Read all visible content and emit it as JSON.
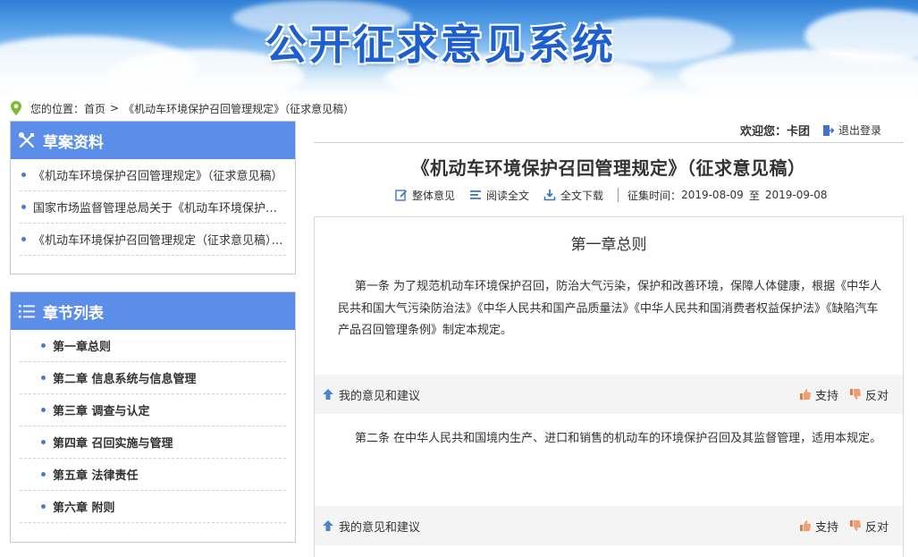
{
  "banner": {
    "title": "公开征求意见系统"
  },
  "breadcrumb": {
    "prefix": "您的位置：",
    "home": "首页",
    "separator": ">",
    "current": "《机动车环境保护召回管理规定》（征求意见稿）"
  },
  "sidebar": {
    "docs_panel": {
      "title": "草案资料",
      "items": [
        {
          "label": "《机动车环境保护召回管理规定》（征求意见稿）"
        },
        {
          "label": "国家市场监督管理总局关于《机动车环境保护召回管理规定》"
        },
        {
          "label": "《机动车环境保护召回管理规定（征求意见稿）》起草说明"
        }
      ]
    },
    "chapters_panel": {
      "title": "章节列表",
      "items": [
        {
          "label": "第一章总则"
        },
        {
          "label": "第二章 信息系统与信息管理"
        },
        {
          "label": "第三章 调查与认定"
        },
        {
          "label": "第四章 召回实施与管理"
        },
        {
          "label": "第五章 法律责任"
        },
        {
          "label": "第六章 附则"
        }
      ]
    }
  },
  "user": {
    "welcome_label": "欢迎您：",
    "username": "卡团",
    "logout_label": "退出登录"
  },
  "document": {
    "title": "《机动车环境保护召回管理规定》（征求意见稿）",
    "toolbar": {
      "overall_opinion": "整体意见",
      "read_full": "阅读全文",
      "download_full": "全文下载",
      "period_label": "征集时间：",
      "period_start": "2019-08-09",
      "period_to": "至",
      "period_end": "2019-09-08"
    },
    "chapter_title": "第一章总则",
    "articles": [
      {
        "text": "第一条 为了规范机动车环境保护召回，防治大气污染，保护和改善环境，保障人体健康，根据《中华人民共和国大气污染防治法》《中华人民共和国产品质量法》《中华人民共和国消费者权益保护法》《缺陷汽车产品召回管理条例》制定本规定。"
      },
      {
        "text": "第二条 在中华人民共和国境内生产、进口和销售的机动车的环境保护召回及其监督管理，适用本规定。"
      }
    ],
    "opinion_bar": {
      "my_opinion": "我的意见和建议",
      "support": "支持",
      "oppose": "反对"
    }
  },
  "colors": {
    "panel_header": "#5b8ee8",
    "banner_title": "#1d5fcf",
    "bullet": "#4a7bd4"
  }
}
